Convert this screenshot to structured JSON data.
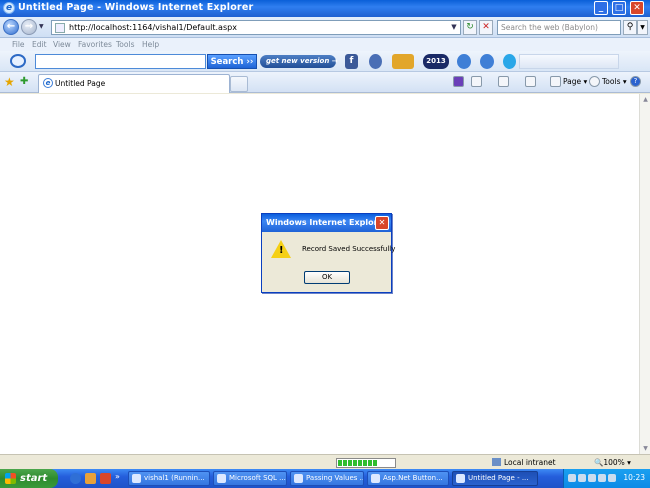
{
  "window": {
    "title": "Untitled Page - Windows Internet Explorer",
    "minimize_label": "_",
    "maximize_label": "□",
    "close_label": "✕"
  },
  "address_bar": {
    "back_label": "←",
    "forward_label": "→",
    "url": "http://localhost:1164/vishal1/Default.aspx",
    "dropdown_label": "▼",
    "refresh_label": "↻",
    "stop_label": "✕",
    "web_search_placeholder": "Search the web (Babylon)",
    "web_search_go": "⚲"
  },
  "menu": [
    "File",
    "Edit",
    "View",
    "Favorites",
    "Tools",
    "Help"
  ],
  "toolbar": {
    "search_value": "",
    "search_label": "Search ››",
    "get_new_version_label": "get new version →",
    "badge_2013": "2013",
    "facebook_label": "f"
  },
  "tab": {
    "favorites_star": "★",
    "add_favorite": "✚",
    "label": "Untitled Page"
  },
  "commands": {
    "page_label": "Page ▾",
    "tools_label": "Tools ▾",
    "help_label": "?"
  },
  "dialog": {
    "title": "Windows Internet Explorer",
    "close_label": "✕",
    "warning_mark": "!",
    "message": "Record Saved Successfully",
    "ok_label": "OK"
  },
  "statusbar": {
    "progress_fraction": 0.7,
    "zone": "Local intranet",
    "zoom": "🔍100%  ▾"
  },
  "taskbar": {
    "start_label": "start",
    "chevron": "»",
    "tasks": [
      "vishal1 (Runnin...",
      "Microsoft SQL ...",
      "Passing Values ...",
      "Asp.Net Button...",
      "Untitled Page - ..."
    ],
    "clock": "10:23"
  },
  "colors": {
    "titlebar": "#1d5fd0",
    "start_green": "#2e8b2e",
    "dialog_border": "#0a3fbf",
    "warning_yellow": "#f5d016"
  }
}
